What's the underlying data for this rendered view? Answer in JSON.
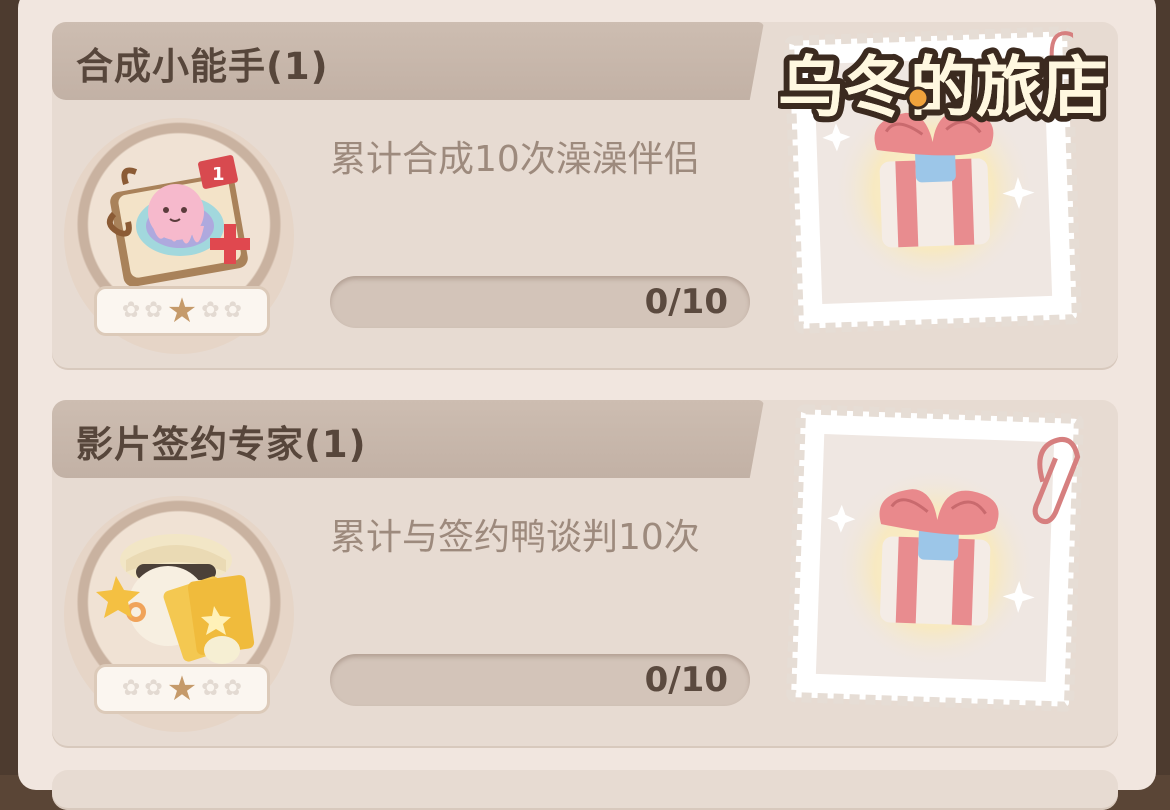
{
  "logo": {
    "text": "乌冬的旅店"
  },
  "tasks": [
    {
      "title": "合成小能手(1)",
      "description": "累计合成10次澡澡伴侣",
      "progress_text": "0/10",
      "progress": 0,
      "stars_filled": 1,
      "stars_total": 5
    },
    {
      "title": "影片签约专家(1)",
      "description": "累计与签约鸭谈判10次",
      "progress_text": "0/10",
      "progress": 0,
      "stars_filled": 1,
      "stars_total": 5
    }
  ],
  "colors": {
    "panel": "#f1e6df",
    "card": "#e7dbd2",
    "title_band": "#c6b5a9",
    "title_text": "#57463b",
    "desc_text": "#9d8a7d",
    "progress_track": "#d3c4b9",
    "gift_ribbon": "#e88c8f"
  },
  "icons": [
    "merge-book-badge-icon",
    "film-contract-badge-icon",
    "gift-box-icon",
    "paperclip-icon",
    "star-icon"
  ]
}
